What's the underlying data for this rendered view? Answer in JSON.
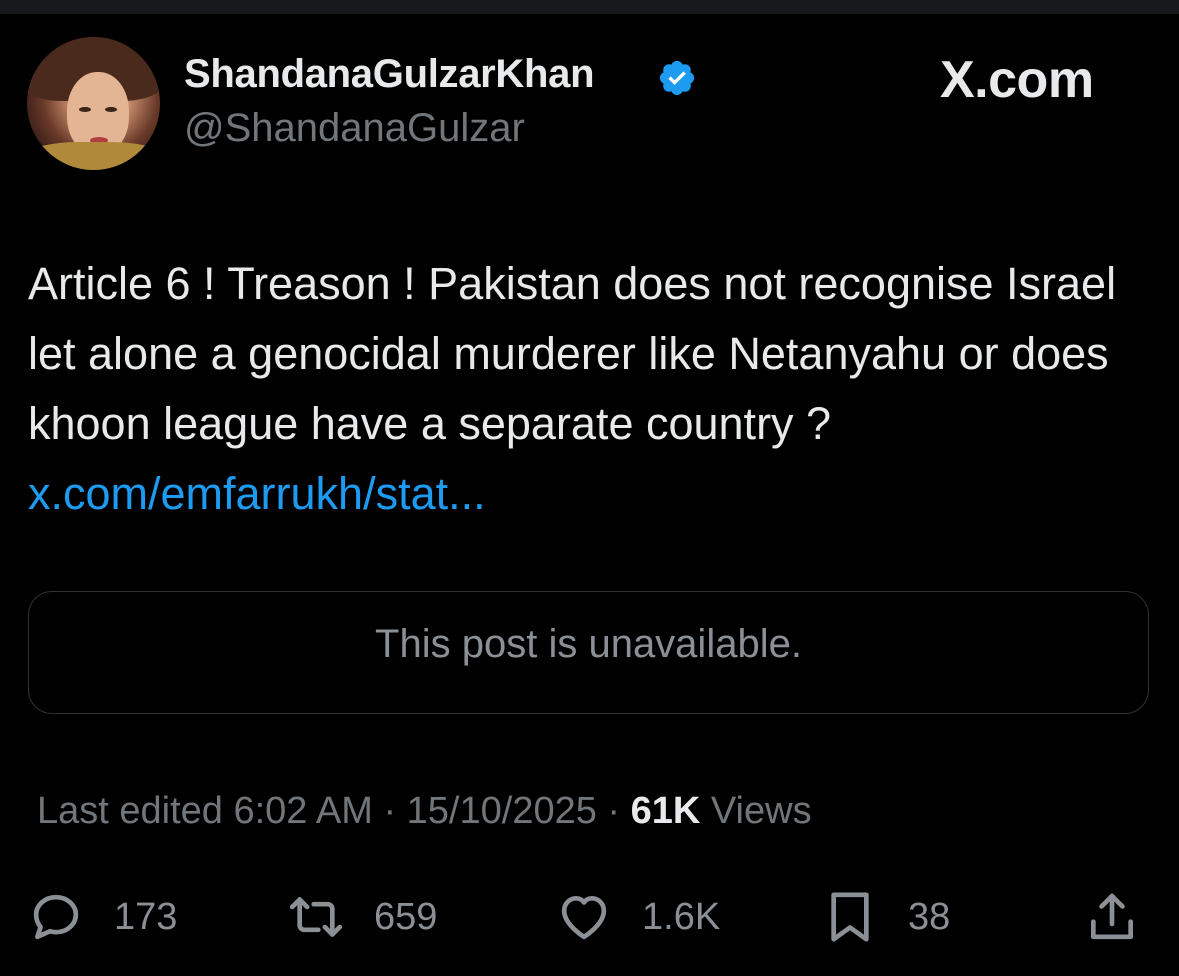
{
  "author": {
    "display_name": "ShandanaGulzarKhan",
    "handle": "@ShandanaGulzar",
    "verified_color": "#1d9bf0"
  },
  "watermark": "X.com",
  "post": {
    "text": "Article 6 ! Treason ! Pakistan does not recognise Israel let alone a genocidal murderer like Netanyahu or does khoon league have a separate country  ? ",
    "link_text": "x.com/emfarrukh/stat..."
  },
  "quoted_post": {
    "text": "This post is unavailable."
  },
  "meta": {
    "edited_prefix": "Last edited 6:02 AM · 15/10/2025 · ",
    "views_count": "61K",
    "views_label": " Views"
  },
  "actions": {
    "replies": "173",
    "reposts": "659",
    "likes": "1.6K",
    "bookmarks": "38"
  },
  "colors": {
    "background": "#000000",
    "text": "#e7e9ea",
    "secondary": "#71767b",
    "link": "#1d9bf0"
  }
}
